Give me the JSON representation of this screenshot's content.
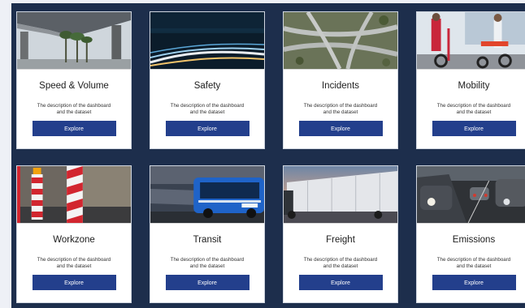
{
  "cards": [
    {
      "title": "Speed & Volume",
      "description": "The description of the dashboard and the dataset",
      "button": "Explore",
      "image": "highway-overpass-palms"
    },
    {
      "title": "Safety",
      "description": "The description of the dashboard and the dataset",
      "button": "Explore",
      "image": "night-traffic-light-trails"
    },
    {
      "title": "Incidents",
      "description": "The description of the dashboard and the dataset",
      "button": "Explore",
      "image": "aerial-interchange"
    },
    {
      "title": "Mobility",
      "description": "The description of the dashboard and the dataset",
      "button": "Explore",
      "image": "e-scooters"
    },
    {
      "title": "Workzone",
      "description": "The description of the dashboard and the dataset",
      "button": "Explore",
      "image": "construction-barriers"
    },
    {
      "title": "Transit",
      "description": "The description of the dashboard and the dataset",
      "button": "Explore",
      "image": "city-bus"
    },
    {
      "title": "Freight",
      "description": "The description of the dashboard and the dataset",
      "button": "Explore",
      "image": "semi-truck-sunset"
    },
    {
      "title": "Emissions",
      "description": "The description of the dashboard and the dataset",
      "button": "Explore",
      "image": "traffic-jam"
    }
  ],
  "colors": {
    "panel": "#1d2e4c",
    "button": "#233f8c",
    "card": "#ffffff"
  }
}
